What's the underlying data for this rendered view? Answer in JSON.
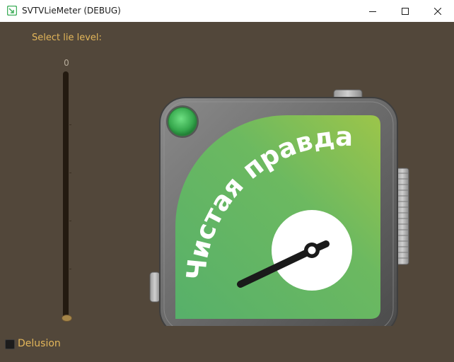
{
  "window": {
    "title": "SVTVLieMeter (DEBUG)",
    "minimize_icon": "minimize-icon",
    "maximize_icon": "maximize-icon",
    "close_icon": "close-icon"
  },
  "controls": {
    "select_label": "Select lie level:",
    "slider_value": "0",
    "slider_level": 0,
    "checkbox_label": "Delusion",
    "checkbox_checked": false
  },
  "meter": {
    "reading": "Чистая правда",
    "indicator_color": "#3fb85a",
    "face_color": "#6dbb5a"
  }
}
